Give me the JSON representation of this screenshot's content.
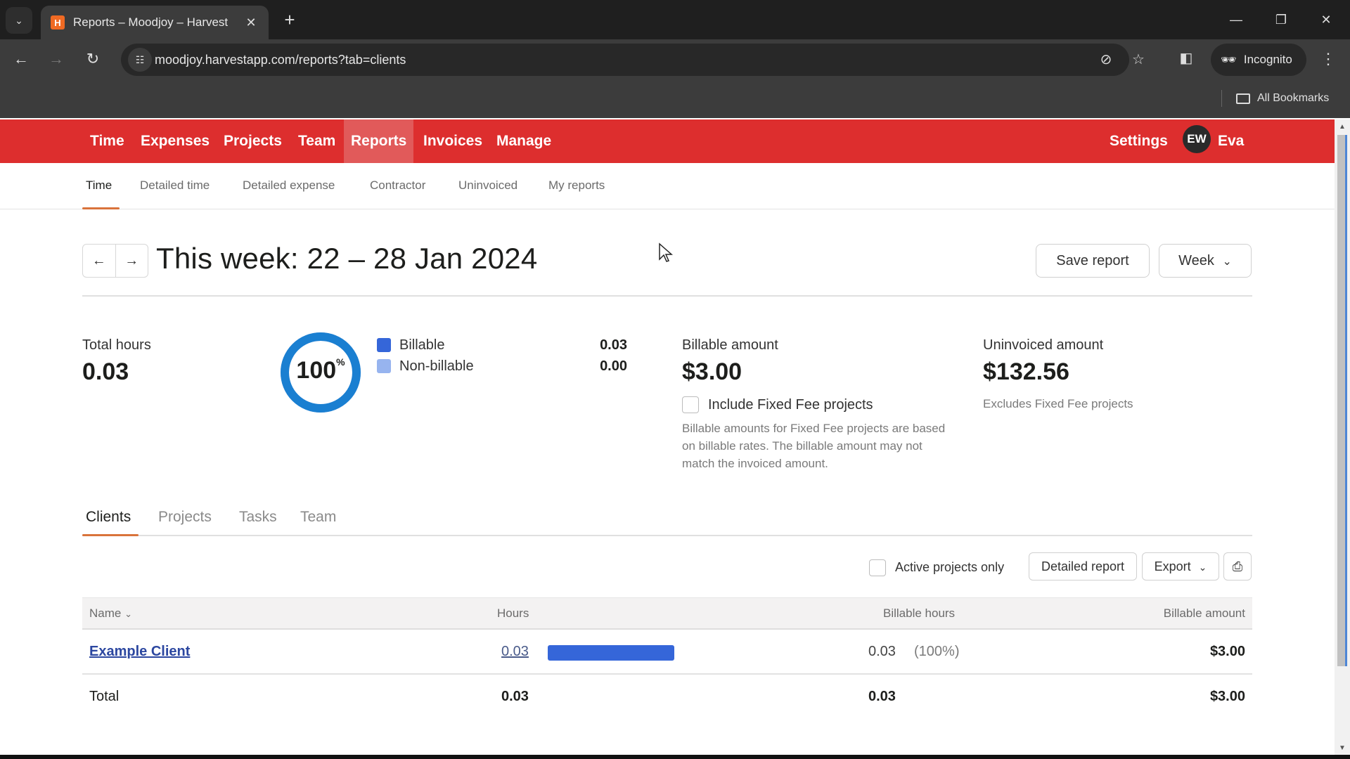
{
  "browser": {
    "tab_title": "Reports – Moodjoy – Harvest",
    "favicon_letter": "H",
    "url": "moodjoy.harvestapp.com/reports?tab=clients",
    "incognito_label": "Incognito",
    "bookmarks_label": "All Bookmarks",
    "icons": {
      "tab_search": "chevron-down-icon",
      "close_tab": "close-icon",
      "new_tab": "plus-icon",
      "minimize": "minimize-icon",
      "restore": "restore-icon",
      "close_window": "close-icon",
      "back": "arrow-left-icon",
      "forward": "arrow-right-icon",
      "reload": "reload-icon",
      "site_info": "tune-icon",
      "tracking": "eye-off-icon",
      "bookmark": "star-icon",
      "side_panel": "side-panel-icon",
      "incognito": "incognito-icon",
      "menu": "kebab-menu-icon",
      "folder": "folder-icon"
    }
  },
  "app_nav": {
    "items": [
      {
        "label": "Time"
      },
      {
        "label": "Expenses"
      },
      {
        "label": "Projects"
      },
      {
        "label": "Team"
      },
      {
        "label": "Reports",
        "active": true
      },
      {
        "label": "Invoices"
      },
      {
        "label": "Manage"
      }
    ],
    "settings_label": "Settings",
    "avatar_initials": "EW",
    "user_name": "Eva",
    "brand_color": "#dd2e2e"
  },
  "subnav": {
    "items": [
      {
        "label": "Time",
        "active": true
      },
      {
        "label": "Detailed time"
      },
      {
        "label": "Detailed expense"
      },
      {
        "label": "Contractor"
      },
      {
        "label": "Uninvoiced"
      },
      {
        "label": "My reports"
      }
    ],
    "accent_color": "#d9733b"
  },
  "header": {
    "prev_icon": "←",
    "next_icon": "→",
    "title": "This week: 22 – 28 Jan 2024",
    "save_report_label": "Save report",
    "period_select": "Week"
  },
  "summary": {
    "total_hours_label": "Total hours",
    "total_hours_value": "0.03",
    "donut_percent": "100",
    "donut_percent_sign": "%",
    "billable_fraction": 1.0,
    "legend": [
      {
        "label": "Billable",
        "value": "0.03",
        "color": "#3566d9"
      },
      {
        "label": "Non-billable",
        "value": "0.00",
        "color": "#97b4ef"
      }
    ],
    "billable_amount_label": "Billable amount",
    "billable_amount_value": "$3.00",
    "include_fixed_fee_label": "Include Fixed Fee projects",
    "include_fixed_fee_checked": false,
    "fixed_fee_help": "Billable amounts for Fixed Fee projects are based on billable rates. The billable amount may not match the invoiced amount.",
    "uninvoiced_label": "Uninvoiced amount",
    "uninvoiced_value": "$132.56",
    "uninvoiced_note": "Excludes Fixed Fee projects"
  },
  "report_tabs": {
    "items": [
      {
        "label": "Clients",
        "active": true
      },
      {
        "label": "Projects"
      },
      {
        "label": "Tasks"
      },
      {
        "label": "Team"
      }
    ]
  },
  "table_toolbar": {
    "active_only_label": "Active projects only",
    "active_only_checked": false,
    "detailed_report_label": "Detailed report",
    "export_label": "Export",
    "print_icon": "print-icon"
  },
  "table": {
    "columns": [
      "Name",
      "Hours",
      "Billable hours",
      "Billable amount"
    ],
    "rows": [
      {
        "name": "Example Client",
        "hours": "0.03",
        "hours_fraction": 1.0,
        "billable_hours": "0.03",
        "billable_pct": "(100%)",
        "billable_amount": "$3.00"
      }
    ],
    "total": {
      "label": "Total",
      "hours": "0.03",
      "billable_hours": "0.03",
      "billable_amount": "$3.00"
    }
  }
}
